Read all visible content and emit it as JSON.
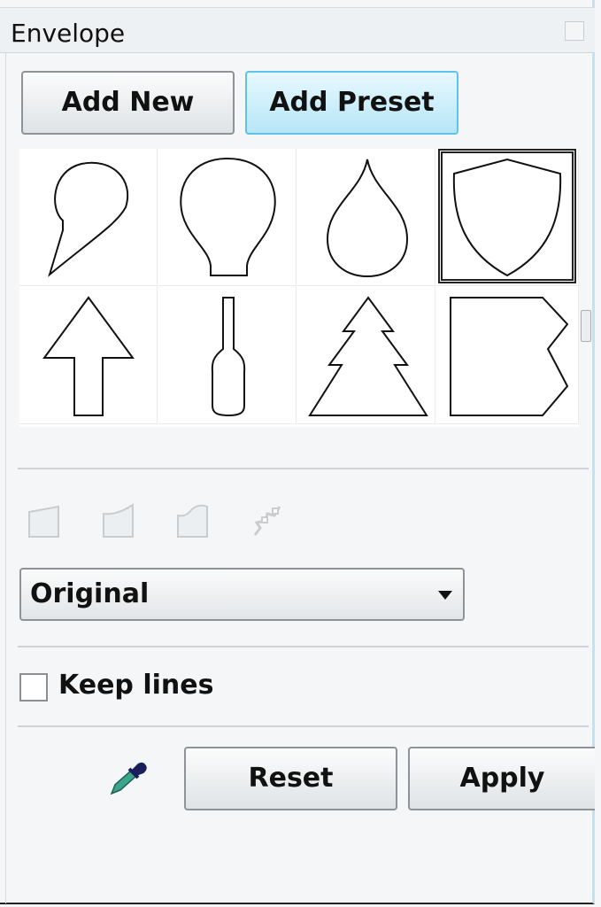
{
  "panel": {
    "title": "Envelope"
  },
  "toolbar": {
    "add_new_label": "Add New",
    "add_preset_label": "Add Preset"
  },
  "presets": [
    {
      "name": "speech-bubble",
      "selected": false
    },
    {
      "name": "light-bulb",
      "selected": false
    },
    {
      "name": "drop",
      "selected": false
    },
    {
      "name": "shield",
      "selected": true
    },
    {
      "name": "arrow-up",
      "selected": false
    },
    {
      "name": "bottle",
      "selected": false
    },
    {
      "name": "tree",
      "selected": false
    },
    {
      "name": "tag",
      "selected": false
    }
  ],
  "modes": [
    {
      "icon": "straight-line-mode-icon",
      "enabled": false
    },
    {
      "icon": "single-arc-mode-icon",
      "enabled": false
    },
    {
      "icon": "double-arc-mode-icon",
      "enabled": false
    },
    {
      "icon": "unconstrained-mode-icon",
      "enabled": false
    }
  ],
  "mapping": {
    "selected": "Original"
  },
  "options": {
    "keep_lines_label": "Keep lines",
    "keep_lines_checked": false
  },
  "actions": {
    "picker_icon": "eyedropper-icon",
    "reset_label": "Reset",
    "apply_label": "Apply"
  },
  "colors": {
    "accent": "#5cc4ea",
    "panel_bg": "#f4f6f8"
  }
}
